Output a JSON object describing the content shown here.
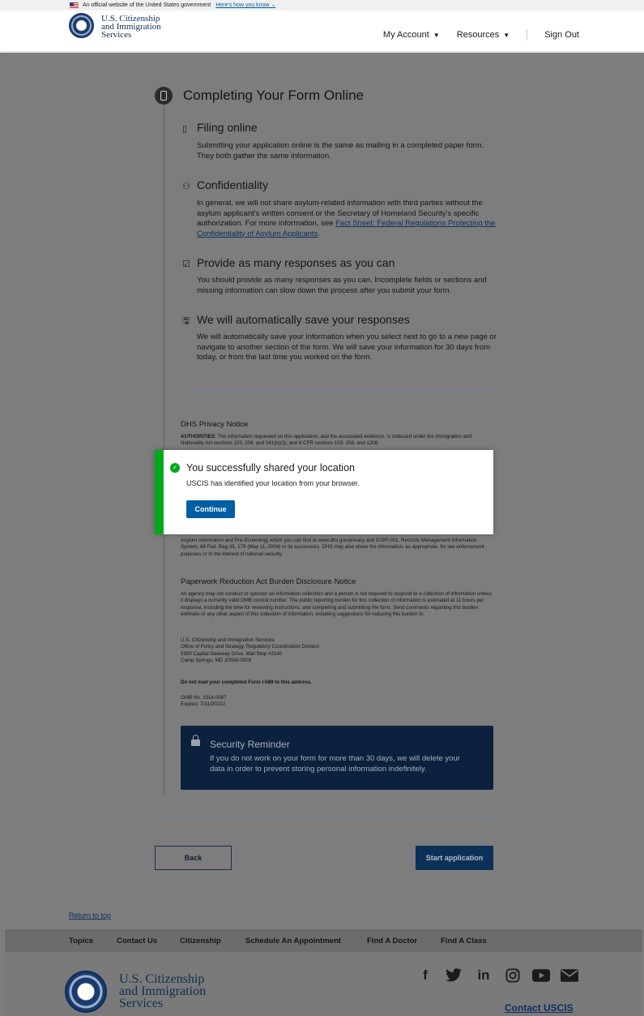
{
  "banner": {
    "text": "An official website of the United States government",
    "link": "Here's how you know",
    "chevron": "⌄"
  },
  "header": {
    "brand_line1": "U.S. Citizenship",
    "brand_line2": "and Immigration",
    "brand_line3": "Services",
    "nav": {
      "my_account": "My Account",
      "resources": "Resources",
      "sign_out": "Sign Out"
    }
  },
  "section": {
    "title": "Completing Your Form Online",
    "items": [
      {
        "icon": "phone-icon",
        "heading": "Filing online",
        "body": "Submitting your application online is the same as mailing in a completed paper form. They both gather the same information."
      },
      {
        "icon": "user-lock-icon",
        "heading": "Confidentiality",
        "body": "In general, we will not share asylum-related information with third parties without the asylum applicant's written consent or the Secretary of Homeland Security's specific authorization. For more information, see ",
        "link": "Fact Sheet: Federal Regulations Protecting the Confidentiality of Asylum Applicants",
        "tail": "."
      },
      {
        "icon": "checkbox-icon",
        "heading": "Provide as many responses as you can",
        "body": "You should provide as many responses as you can. Incomplete fields or sections and missing information can slow down the process after you submit your form."
      },
      {
        "icon": "save-icon",
        "heading": "We will automatically save your responses",
        "body": "We will automatically save your information when you select next to go to a new page or navigate to another section of the form. We will save your information for 30 days from today, or from the last time you worked on the form."
      }
    ]
  },
  "privacy": {
    "heading": "DHS Privacy Notice",
    "authorities_label": "AUTHORITIES:",
    "authorities_text": " The information requested on this application, and the associated evidence, is collected under the Immigration and Nationality Act sections 103, 208, and 241(b)(3), and 8 CFR sections 103, 208, and 1208.",
    "routine_text": "Asylum Information and Pre-Screening) which you can find at www.dhs.gov/privacy and EOIR-001, Records Management Information System, 69 Fed. Reg 26, 179 (May 11, 2004) or its successors. DHS may also share the information, as appropriate, for law enforcement purposes or in the interest of national security."
  },
  "paperwork": {
    "heading": "Paperwork Reduction Act Burden Disclosure Notice",
    "text": "An agency may not conduct or sponsor an information collection and a person is not required to respond to a collection of information unless it displays a currently valid OMB control number. The public reporting burden for this collection of information is estimated at 11 hours per response, including the time for reviewing instructions, and completing and submitting the form. Send comments regarding this burden estimate or any other aspect of this collection of information, including suggestions for reducing this burden to:",
    "address": [
      "U.S. Citizenship and Immigration Services",
      "Office of Policy and Strategy, Regulatory Coordination Division",
      "5900 Capital Gateway Drive, Mail Stop #2140",
      "Camp Springs, MD 20588-0009"
    ],
    "do_not_mail": "Do not mail your completed Form I-589 to this address.",
    "omb": "OMB No. 1516-0067",
    "expires": "Expires: 7/31/20222"
  },
  "security": {
    "title": "Security Reminder",
    "body": "If you do not work on your form for more than 30 days, we will delete your data in order to prevent storing personal information indefinitely."
  },
  "actions": {
    "back": "Back",
    "start": "Start application"
  },
  "modal": {
    "title": "You successfully shared your location",
    "message": "USCIS has identified your location from your browser.",
    "continue": "Continue",
    "accent": "#00a91c"
  },
  "footer": {
    "return_to_top": "Return to top",
    "links": [
      "Topics",
      "Contact Us",
      "Citizenship",
      "Schedule An Appointment",
      "Find A Doctor",
      "Find A Class"
    ],
    "brand_line1": "U.S. Citizenship",
    "brand_line2": "and Immigration",
    "brand_line3": "Services",
    "social": [
      "facebook-icon",
      "twitter-icon",
      "linkedin-icon",
      "instagram-icon",
      "youtube-icon",
      "email-icon"
    ],
    "contact": "Contact USCIS"
  }
}
